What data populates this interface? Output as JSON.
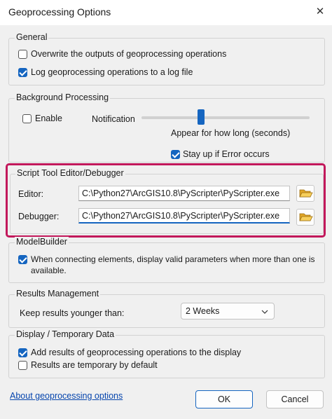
{
  "window": {
    "title": "Geoprocessing Options",
    "close_glyph": "✕"
  },
  "general": {
    "legend": "General",
    "overwrite": {
      "label": "Overwrite the outputs of geoprocessing operations",
      "checked": false
    },
    "log": {
      "label": "Log geoprocessing operations to a log file",
      "checked": true
    }
  },
  "background": {
    "legend": "Background Processing",
    "enable": {
      "label": "Enable",
      "checked": false
    },
    "notification_label": "Notification",
    "slider_caption": "Appear for how long (seconds)",
    "stay_up": {
      "label": "Stay up if Error occurs",
      "checked": true
    }
  },
  "script_tool": {
    "legend": "Script Tool Editor/Debugger",
    "editor_label": "Editor:",
    "editor_value": "C:\\Python27\\ArcGIS10.8\\PyScripter\\PyScripter.exe",
    "debugger_label": "Debugger:",
    "debugger_value": "C:\\Python27\\ArcGIS10.8\\PyScripter\\PyScripter.exe",
    "highlight_color": "#c2185b"
  },
  "modelbuilder": {
    "legend": "ModelBuilder",
    "valid_params": {
      "label_line1": "When connecting elements, display valid parameters when more than one is",
      "label_line2": "available.",
      "checked": true
    }
  },
  "results": {
    "legend": "Results Management",
    "keep_label": "Keep results younger than:",
    "keep_value": "2 Weeks"
  },
  "display": {
    "legend": "Display / Temporary Data",
    "add_results": {
      "label": "Add results of geoprocessing operations to the display",
      "checked": true
    },
    "temporary": {
      "label": "Results are temporary by default",
      "checked": false
    }
  },
  "footer": {
    "about_link": "About geoprocessing options",
    "ok": "OK",
    "cancel": "Cancel"
  },
  "colors": {
    "accent": "#1565c0",
    "link": "#0645ad"
  }
}
